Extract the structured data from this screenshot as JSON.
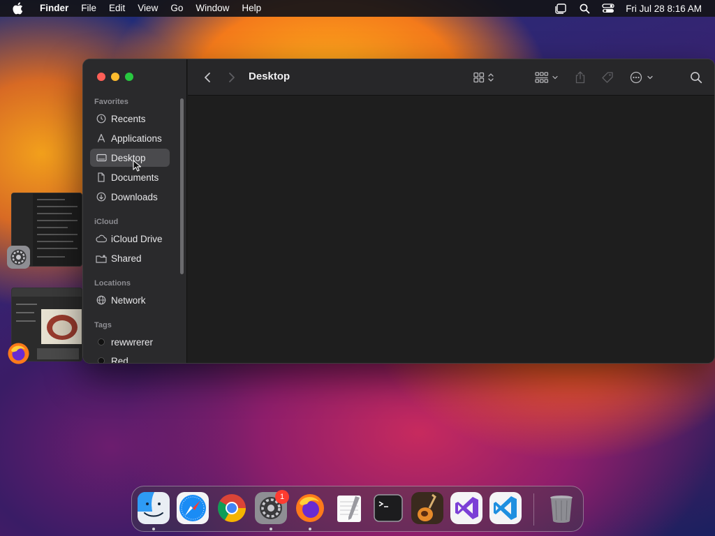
{
  "menubar": {
    "app_name": "Finder",
    "items": [
      "File",
      "Edit",
      "View",
      "Go",
      "Window",
      "Help"
    ],
    "clock": "Fri Jul 28  8:16 AM",
    "icons": [
      "apple-icon",
      "stage-manager-icon",
      "spotlight-icon",
      "control-center-icon"
    ]
  },
  "finder": {
    "title": "Desktop",
    "sidebar": {
      "favorites_header": "Favorites",
      "favorites": [
        {
          "label": "Recents",
          "icon": "clock-icon"
        },
        {
          "label": "Applications",
          "icon": "applications-icon"
        },
        {
          "label": "Desktop",
          "icon": "desktop-icon",
          "selected": true
        },
        {
          "label": "Documents",
          "icon": "document-icon"
        },
        {
          "label": "Downloads",
          "icon": "download-icon"
        }
      ],
      "icloud_header": "iCloud",
      "icloud": [
        {
          "label": "iCloud Drive",
          "icon": "cloud-icon"
        },
        {
          "label": "Shared",
          "icon": "shared-folder-icon"
        }
      ],
      "locations_header": "Locations",
      "locations": [
        {
          "label": "Network",
          "icon": "globe-icon"
        }
      ],
      "tags_header": "Tags",
      "tags": [
        {
          "label": "rewwrerer",
          "color": "#1a1a1a"
        },
        {
          "label": "Red",
          "color": "#1a1a1a"
        }
      ]
    }
  },
  "dock": {
    "apps": [
      "Finder",
      "Safari",
      "Chrome",
      "System Settings",
      "Firefox",
      "TextEdit",
      "Terminal",
      "GarageBand",
      "Visual Studio",
      "VS Code",
      "Trash"
    ],
    "settings_badge": "1"
  },
  "colors": {
    "accent_red": "#ff5f57",
    "accent_yellow": "#febc2e",
    "accent_green": "#28c840",
    "sidebar_bg": "#2a2a2c",
    "window_bg": "#1e1e1e"
  }
}
